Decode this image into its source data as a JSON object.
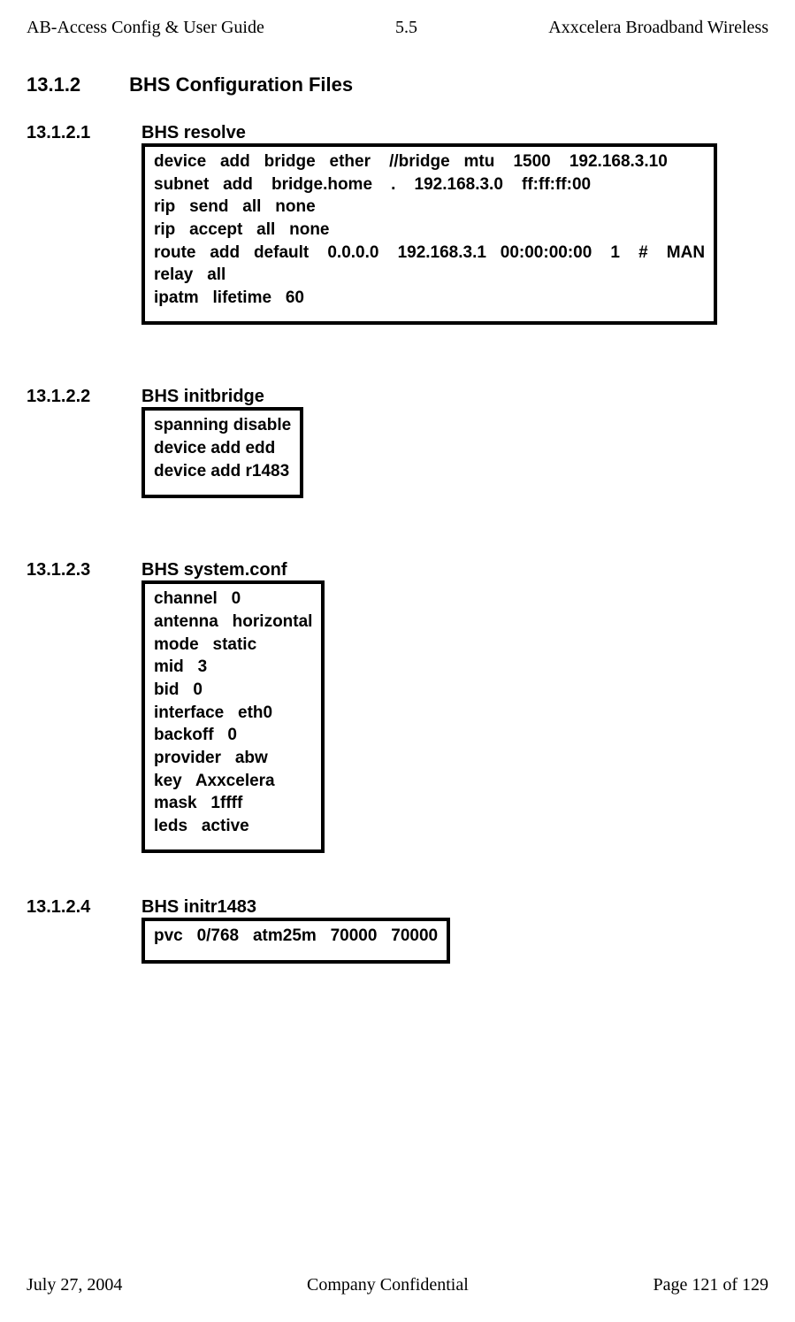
{
  "header": {
    "left": "AB-Access Config & User Guide",
    "center": "5.5",
    "right": "Axxcelera Broadband Wireless"
  },
  "section_main": {
    "num": "13.1.2",
    "title": "BHS Configuration Files"
  },
  "sections": [
    {
      "num": "13.1.2.1",
      "title": "BHS resolve",
      "code": "device   add   bridge   ether    //bridge   mtu    1500    192.168.3.10\nsubnet   add    bridge.home    .    192.168.3.0    ff:ff:ff:00\nrip   send   all   none\nrip   accept   all   none\nroute   add   default    0.0.0.0    192.168.3.1   00:00:00:00    1    #    MAN\nrelay   all\nipatm   lifetime   60"
    },
    {
      "num": "13.1.2.2",
      "title": "BHS initbridge",
      "code": "spanning disable\ndevice add edd\ndevice add r1483"
    },
    {
      "num": "13.1.2.3",
      "title": "BHS system.conf",
      "code": "channel   0\nantenna   horizontal\nmode   static\nmid   3\nbid   0\ninterface   eth0\nbackoff   0\nprovider   abw\nkey   Axxcelera\nmask   1ffff\nleds   active"
    },
    {
      "num": "13.1.2.4",
      "title": "BHS initr1483",
      "code": "pvc   0/768   atm25m   70000   70000"
    }
  ],
  "footer": {
    "left": "July 27, 2004",
    "center": "Company Confidential",
    "right": "Page 121 of 129"
  }
}
